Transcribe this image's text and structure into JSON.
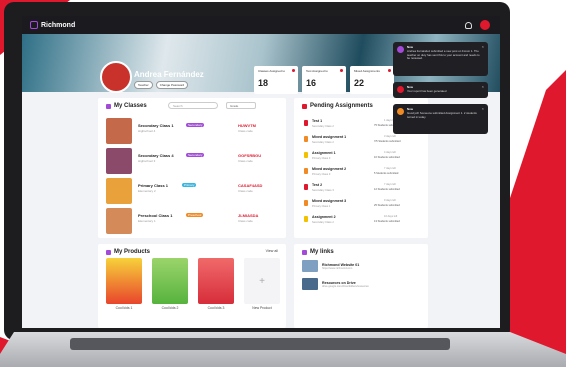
{
  "app": {
    "name": "Richmond"
  },
  "profile": {
    "name": "Andrea Fernández",
    "tags": [
      "Teacher",
      "Change Password"
    ]
  },
  "stats": [
    {
      "label": "Classes Assigned to",
      "value": "18"
    },
    {
      "label": "Test Assigned to",
      "value": "16"
    },
    {
      "label": "Mixed Assignments",
      "value": "22"
    }
  ],
  "my_classes": {
    "title": "My Classes",
    "search_placeholder": "Search",
    "filter_label": "Grade",
    "items": [
      {
        "name": "Secondary Class 1",
        "subtitle": "Highschool 4",
        "badge": "Secondary",
        "badge_color": "#a34bd9",
        "code": "HUWVTM",
        "code_sub": "Class code",
        "thumb": "#c46a4a"
      },
      {
        "name": "Secondary Class 4",
        "subtitle": "Highschool 3",
        "badge": "Secondary",
        "badge_color": "#a34bd9",
        "code": "GOFSRBGU",
        "code_sub": "Class code",
        "thumb": "#8c4a6a"
      },
      {
        "name": "Primary Class 1",
        "subtitle": "Elementary 2",
        "badge": "Primary",
        "badge_color": "#38b6e0",
        "code": "CASAF4ASD",
        "code_sub": "Class code",
        "thumb": "#e9a13b"
      },
      {
        "name": "Preschool Class 1",
        "subtitle": "Elementary 1",
        "badge": "Preschool",
        "badge_color": "#f08a24",
        "code": "JLMIASDA",
        "code_sub": "Class code",
        "thumb": "#d58a5a"
      }
    ]
  },
  "pending": {
    "title": "Pending Assignments",
    "items": [
      {
        "title": "Test 1",
        "sub": "Secondary Class 2",
        "date": "1 days left",
        "status": "75 Students submitted",
        "color": "#e0182d"
      },
      {
        "title": "Mixed assignment 1",
        "sub": "Secondary Class 2",
        "date": "3 days left",
        "status": "7/5 Students submitted",
        "color": "#f08a24"
      },
      {
        "title": "Assignment 1",
        "sub": "Primary Class 3",
        "date": "4 days left",
        "status": "10 Students submitted",
        "color": "#f2c200"
      },
      {
        "title": "Mixed assignment 2",
        "sub": "Primary Class 3",
        "date": "7 days left",
        "status": "5 Students submitted",
        "color": "#f08a24"
      },
      {
        "title": "Test 2",
        "sub": "Secondary Class 3",
        "date": "7 days left",
        "status": "12 Students submitted",
        "color": "#e0182d"
      },
      {
        "title": "Mixed assignment 3",
        "sub": "Primary Class 1",
        "date": "9 days left",
        "status": "25 Students submitted",
        "color": "#f08a24"
      },
      {
        "title": "Assignment 2",
        "sub": "Secondary Class 2",
        "date": "10 days left",
        "status": "13 Students submitted",
        "color": "#f2c200"
      }
    ]
  },
  "products": {
    "title": "My Products",
    "view_all": "View all",
    "items": [
      {
        "label": "Cool kids 1",
        "color": "#e8452c"
      },
      {
        "label": "Cool kids 2",
        "color": "#57b33e"
      },
      {
        "label": "Cool kids 3",
        "color": "#d62d3a"
      }
    ],
    "new_label": "New Product",
    "new_symbol": "+"
  },
  "links": {
    "title": "My links",
    "items": [
      {
        "title": "Richmond Website 01",
        "sub": "https://www.richmond.com"
      },
      {
        "title": "Resources on Drive",
        "sub": "drive.google.com/drive/folders/resources"
      }
    ]
  },
  "notifications": [
    {
      "name": "Now",
      "body": "Andrea Fernández submitted a new post on Forum 1. The teacher on duty has sent this to your account and needs to be reviewed.",
      "color": "#a34bd9"
    },
    {
      "name": "Now",
      "body": "Your report has been generated",
      "color": "#e0182d"
    },
    {
      "name": "Now",
      "body": "Good job! Someone submitted Assignment 1. 2 students turned in today.",
      "color": "#f08a24"
    }
  ]
}
